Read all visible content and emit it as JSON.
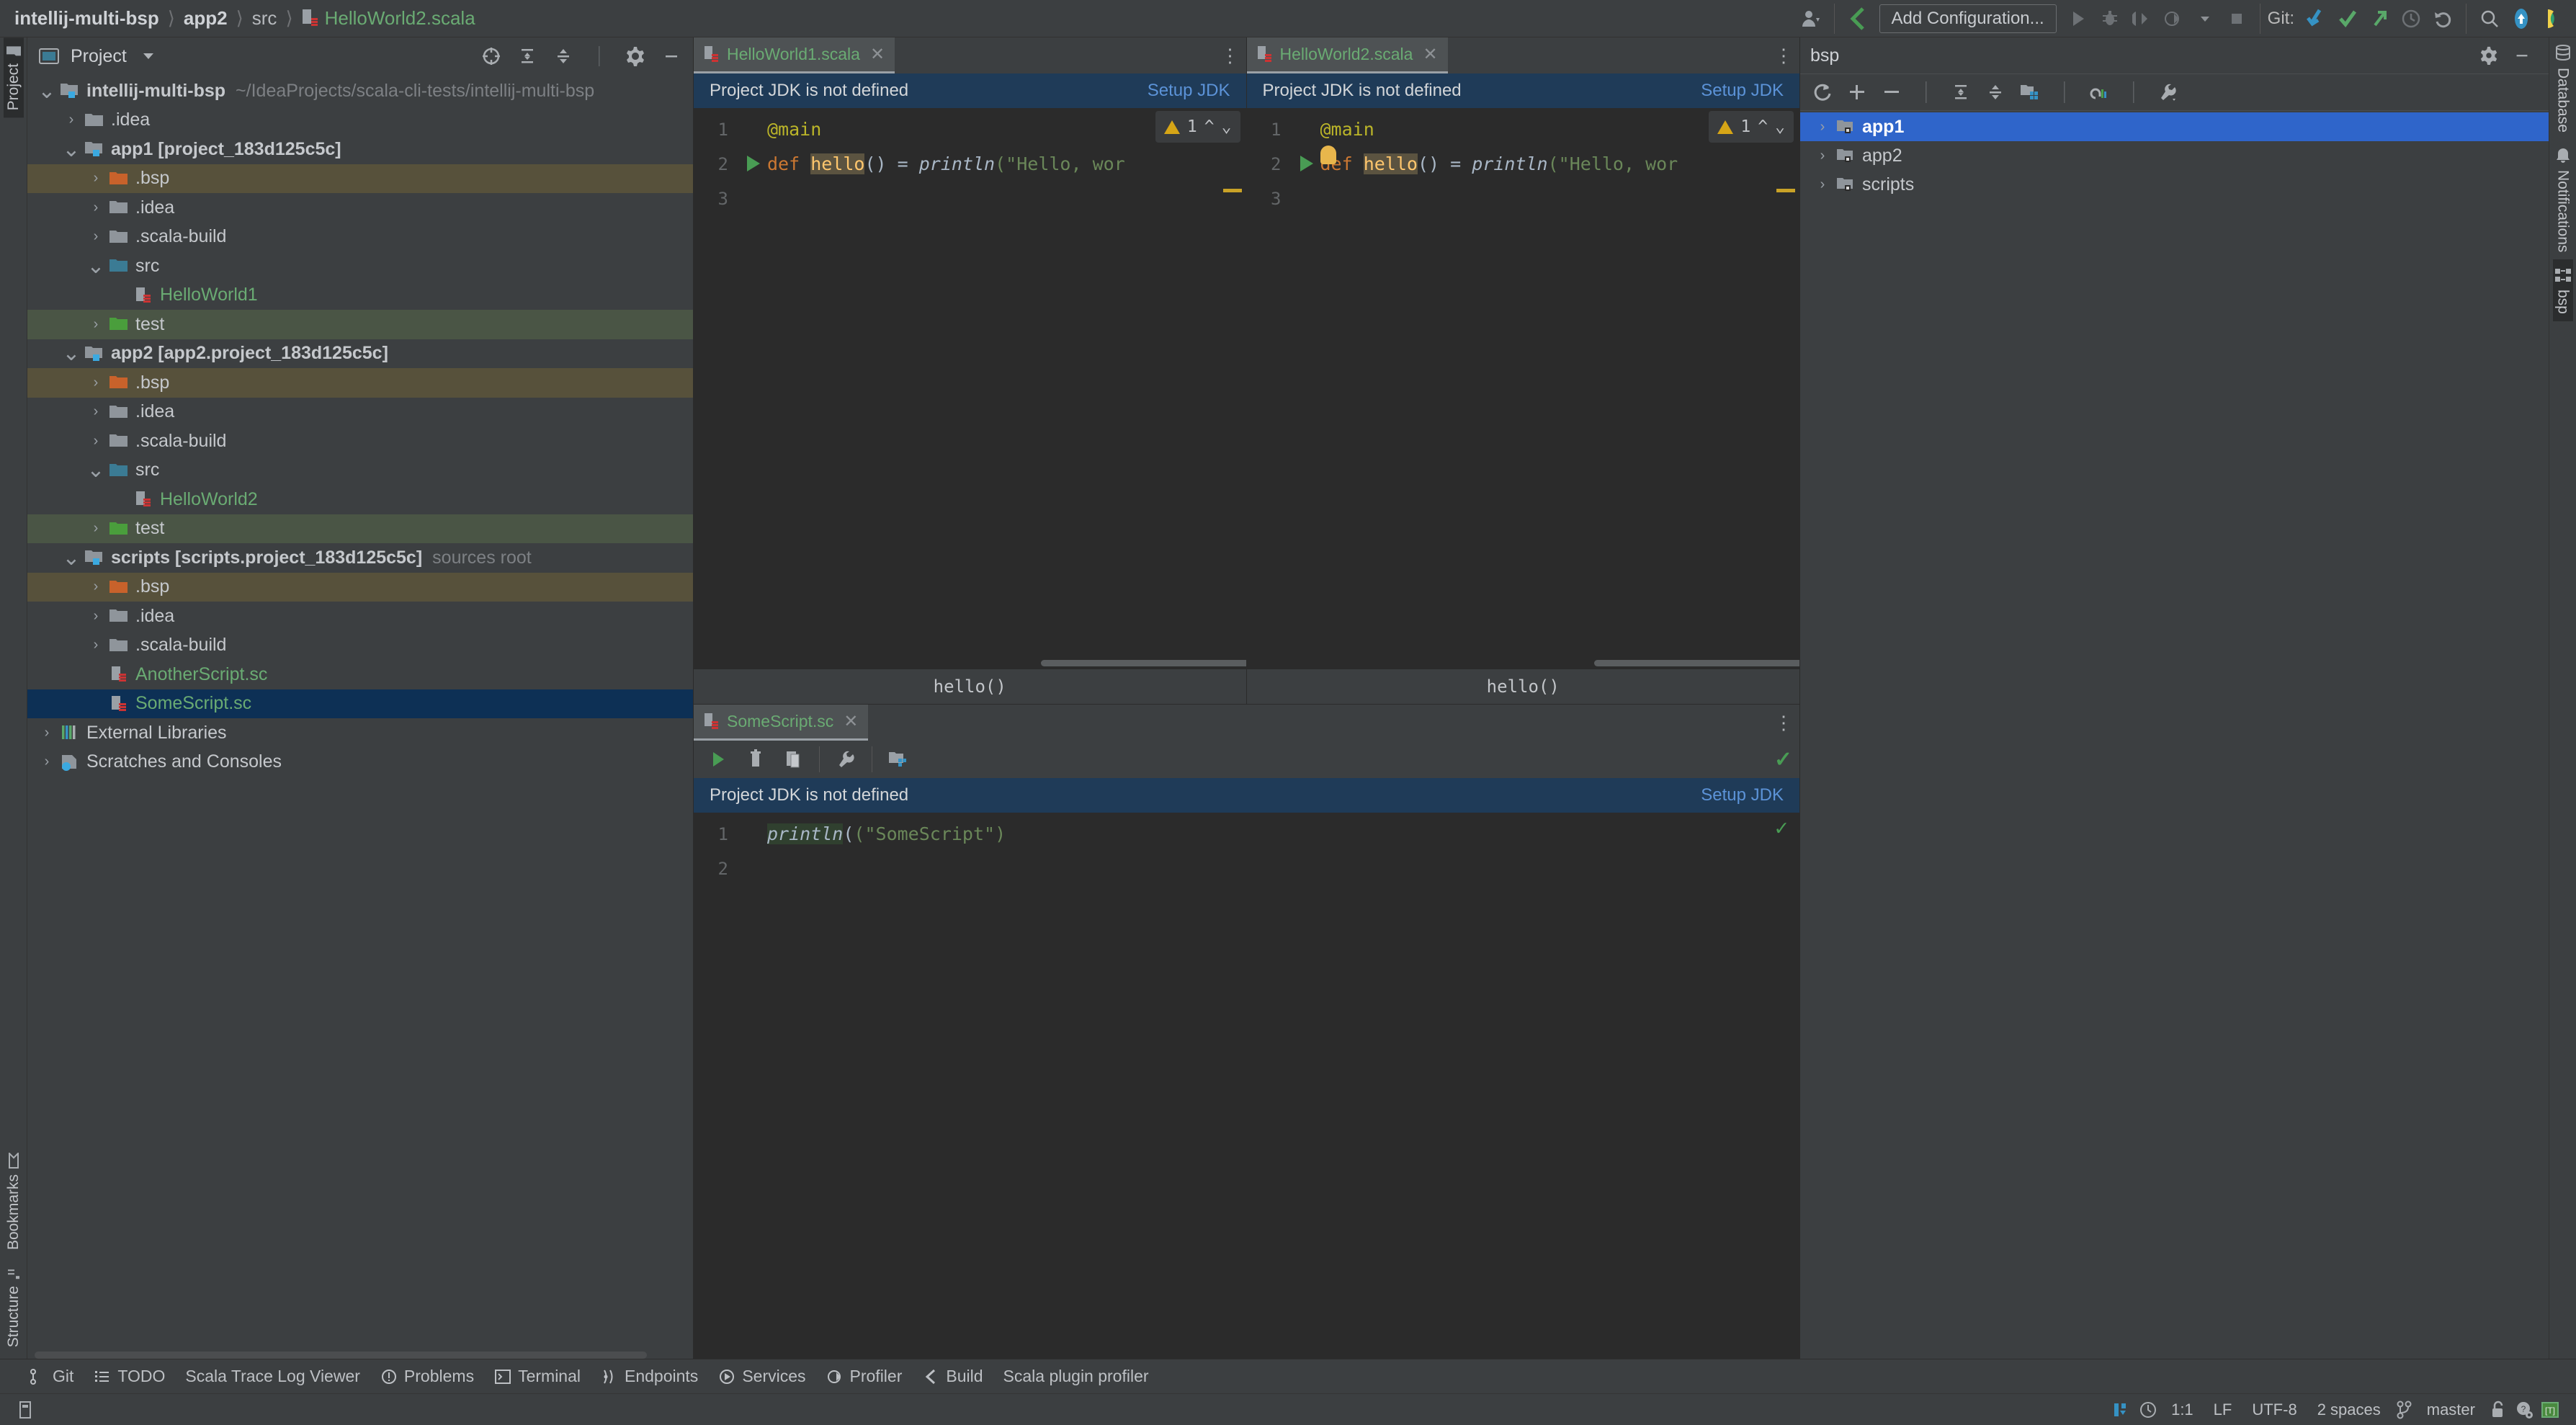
{
  "breadcrumb": {
    "items": [
      {
        "label": "intellij-multi-bsp",
        "style": "bold"
      },
      {
        "label": "app2",
        "style": "bold"
      },
      {
        "label": "src",
        "style": "normal"
      },
      {
        "label": "HelloWorld2.scala",
        "style": "file"
      }
    ],
    "separator": "〉"
  },
  "toolbar": {
    "add_configuration_label": "Add Configuration...",
    "git_label": "Git:",
    "icons": [
      "user-avatar-icon",
      "scala-build-icon",
      "run-icon",
      "debug-icon",
      "run-coverage-icon",
      "profile-icon",
      "dropdown-icon",
      "stop-icon",
      "git-update-icon",
      "git-commit-icon",
      "git-push-icon",
      "git-history-icon",
      "git-rollback-icon",
      "search-everywhere-icon",
      "updates-icon",
      "ide-theme-icon"
    ]
  },
  "left_rail": {
    "top_tab": "Project",
    "bottom_tabs": [
      "Bookmarks",
      "Structure"
    ]
  },
  "right_rail": {
    "tabs": [
      "Database",
      "Notifications",
      "bsp"
    ]
  },
  "project_panel": {
    "title": "Project",
    "toolbar_icons": [
      "select-opened-file-icon",
      "expand-all-icon",
      "collapse-all-icon",
      "gear-icon",
      "hide-icon"
    ],
    "tree": [
      {
        "id": "root",
        "label": "intellij-multi-bsp",
        "suffix": "~/IdeaProjects/scala-cli-tests/intellij-multi-bsp",
        "depth": 0,
        "arrow": "down",
        "icon": "module-folder-icon",
        "bold": true,
        "highlight": "none"
      },
      {
        "id": "idea0",
        "label": ".idea",
        "suffix": "",
        "depth": 1,
        "arrow": "right",
        "icon": "folder-gray-icon",
        "bold": false,
        "highlight": "none"
      },
      {
        "id": "app1",
        "label": "app1 [project_183d125c5c]",
        "suffix": "",
        "depth": 1,
        "arrow": "down",
        "icon": "module-folder-icon",
        "bold": true,
        "highlight": "none"
      },
      {
        "id": "app1bsp",
        "label": ".bsp",
        "suffix": "",
        "depth": 2,
        "arrow": "right",
        "icon": "folder-orange-icon",
        "bold": false,
        "highlight": "bsp"
      },
      {
        "id": "app1idea",
        "label": ".idea",
        "suffix": "",
        "depth": 2,
        "arrow": "right",
        "icon": "folder-gray-icon",
        "bold": false,
        "highlight": "none"
      },
      {
        "id": "app1sb",
        "label": ".scala-build",
        "suffix": "",
        "depth": 2,
        "arrow": "right",
        "icon": "folder-gray-icon",
        "bold": false,
        "highlight": "none"
      },
      {
        "id": "app1src",
        "label": "src",
        "suffix": "",
        "depth": 2,
        "arrow": "down",
        "icon": "folder-blue-icon",
        "bold": false,
        "highlight": "none"
      },
      {
        "id": "hw1",
        "label": "HelloWorld1",
        "suffix": "",
        "depth": 3,
        "arrow": "none",
        "icon": "scala-file-icon",
        "bold": false,
        "highlight": "none",
        "color": "green"
      },
      {
        "id": "app1test",
        "label": "test",
        "suffix": "",
        "depth": 2,
        "arrow": "right",
        "icon": "folder-green-icon",
        "bold": false,
        "highlight": "test"
      },
      {
        "id": "app2",
        "label": "app2 [app2.project_183d125c5c]",
        "suffix": "",
        "depth": 1,
        "arrow": "down",
        "icon": "module-folder-icon",
        "bold": true,
        "highlight": "none"
      },
      {
        "id": "app2bsp",
        "label": ".bsp",
        "suffix": "",
        "depth": 2,
        "arrow": "right",
        "icon": "folder-orange-icon",
        "bold": false,
        "highlight": "bsp"
      },
      {
        "id": "app2idea",
        "label": ".idea",
        "suffix": "",
        "depth": 2,
        "arrow": "right",
        "icon": "folder-gray-icon",
        "bold": false,
        "highlight": "none"
      },
      {
        "id": "app2sb",
        "label": ".scala-build",
        "suffix": "",
        "depth": 2,
        "arrow": "right",
        "icon": "folder-gray-icon",
        "bold": false,
        "highlight": "none"
      },
      {
        "id": "app2src",
        "label": "src",
        "suffix": "",
        "depth": 2,
        "arrow": "down",
        "icon": "folder-blue-icon",
        "bold": false,
        "highlight": "none"
      },
      {
        "id": "hw2",
        "label": "HelloWorld2",
        "suffix": "",
        "depth": 3,
        "arrow": "none",
        "icon": "scala-file-icon",
        "bold": false,
        "highlight": "none",
        "color": "green"
      },
      {
        "id": "app2test",
        "label": "test",
        "suffix": "",
        "depth": 2,
        "arrow": "right",
        "icon": "folder-green-icon",
        "bold": false,
        "highlight": "test"
      },
      {
        "id": "scripts",
        "label": "scripts [scripts.project_183d125c5c]",
        "suffix": "sources root",
        "depth": 1,
        "arrow": "down",
        "icon": "module-folder-icon",
        "bold": true,
        "highlight": "none"
      },
      {
        "id": "scbsp",
        "label": ".bsp",
        "suffix": "",
        "depth": 2,
        "arrow": "right",
        "icon": "folder-orange-icon",
        "bold": false,
        "highlight": "bsp"
      },
      {
        "id": "scidea",
        "label": ".idea",
        "suffix": "",
        "depth": 2,
        "arrow": "right",
        "icon": "folder-gray-icon",
        "bold": false,
        "highlight": "none"
      },
      {
        "id": "scsb",
        "label": ".scala-build",
        "suffix": "",
        "depth": 2,
        "arrow": "right",
        "icon": "folder-gray-icon",
        "bold": false,
        "highlight": "none"
      },
      {
        "id": "another",
        "label": "AnotherScript.sc",
        "suffix": "",
        "depth": 2,
        "arrow": "none",
        "icon": "scala-file-icon",
        "bold": false,
        "highlight": "none",
        "color": "green"
      },
      {
        "id": "somesc",
        "label": "SomeScript.sc",
        "suffix": "",
        "depth": 2,
        "arrow": "none",
        "icon": "scala-file-icon",
        "bold": false,
        "highlight": "blue",
        "color": "green"
      },
      {
        "id": "extlibs",
        "label": "External Libraries",
        "suffix": "",
        "depth": 0,
        "arrow": "right",
        "icon": "libraries-icon",
        "bold": false,
        "highlight": "none"
      },
      {
        "id": "scratches",
        "label": "Scratches and Consoles",
        "suffix": "",
        "depth": 0,
        "arrow": "right",
        "icon": "scratches-icon",
        "bold": false,
        "highlight": "none"
      }
    ]
  },
  "editors": {
    "top_panes": [
      {
        "tab_label": "HelloWorld1.scala",
        "notification": "Project JDK is not defined",
        "notification_action": "Setup JDK",
        "lines": [
          "1",
          "2",
          "3"
        ],
        "code_line1": "@main",
        "code_def": "def",
        "code_name": "hello",
        "code_tail": "() = ",
        "code_fn": "println",
        "code_str": "(\"Hello, wor",
        "inspection_count": "1",
        "status_line": "hello()",
        "has_lightbulb": false
      },
      {
        "tab_label": "HelloWorld2.scala",
        "notification": "Project JDK is not defined",
        "notification_action": "Setup JDK",
        "lines": [
          "1",
          "2",
          "3"
        ],
        "code_line1": "@main",
        "code_def": "def",
        "code_name": "hello",
        "code_tail": "() = ",
        "code_fn": "println",
        "code_str": "(\"Hello, wor",
        "inspection_count": "1",
        "status_line": "hello()",
        "has_lightbulb": true
      }
    ],
    "bottom_pane": {
      "tab_label": "SomeScript.sc",
      "toolbar_icons": [
        "run-icon",
        "delete-icon",
        "copy-icon",
        "settings-wrench-icon",
        "module-icon"
      ],
      "notification": "Project JDK is not defined",
      "notification_action": "Setup JDK",
      "lines": [
        "1",
        "2"
      ],
      "code_fn": "println",
      "code_rest": "(\"SomeScript\")"
    }
  },
  "bsp_panel": {
    "title": "bsp",
    "header_icons": [
      "gear-icon",
      "hide-icon"
    ],
    "toolbar_icons": [
      "reload-icon",
      "add-icon",
      "remove-icon",
      "expand-all-icon",
      "collapse-all-icon",
      "show-modules-icon",
      "attach-icon",
      "build-settings-icon"
    ],
    "tree": [
      {
        "label": "app1",
        "selected": true
      },
      {
        "label": "app2",
        "selected": false
      },
      {
        "label": "scripts",
        "selected": false
      }
    ]
  },
  "bottom_toolwindows": [
    {
      "label": "Git",
      "icon": "git-branch-icon"
    },
    {
      "label": "TODO",
      "icon": "todo-list-icon"
    },
    {
      "label": "Scala Trace Log Viewer",
      "icon": "none"
    },
    {
      "label": "Problems",
      "icon": "problems-icon"
    },
    {
      "label": "Terminal",
      "icon": "terminal-icon"
    },
    {
      "label": "Endpoints",
      "icon": "endpoints-icon"
    },
    {
      "label": "Services",
      "icon": "services-icon"
    },
    {
      "label": "Profiler",
      "icon": "profiler-icon"
    },
    {
      "label": "Build",
      "icon": "build-icon"
    },
    {
      "label": "Scala plugin profiler",
      "icon": "none"
    }
  ],
  "status_bar": {
    "caret_position": "1:1",
    "line_separator": "LF",
    "encoding": "UTF-8",
    "indent": "2 spaces",
    "branch": "master",
    "icons_left": [
      "memory-indicator-icon"
    ],
    "icons_right": [
      "inspections-icon",
      "clock-icon",
      "lock-icon",
      "help-icon",
      "theme-toggle-icon"
    ]
  },
  "colors": {
    "accent_blue": "#2f65ca",
    "link_blue": "#5c93d8",
    "notification_bg": "#1f3b58",
    "green_text": "#6aab73",
    "panel_bg": "#3c3f41",
    "editor_bg": "#2b2b2b",
    "bsp_highlight": "#57513b",
    "test_highlight": "#4a5545",
    "selected_blue": "#0d3055"
  }
}
